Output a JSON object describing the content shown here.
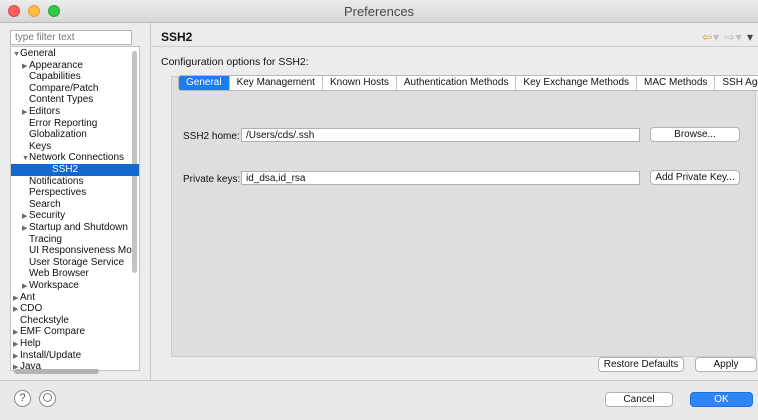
{
  "window": {
    "title": "Preferences"
  },
  "filter": {
    "placeholder": "type filter text"
  },
  "tree": [
    {
      "label": "General",
      "indent": 0,
      "twisty": "▼",
      "selected": false
    },
    {
      "label": "Appearance",
      "indent": 1,
      "twisty": "▶",
      "selected": false
    },
    {
      "label": "Capabilities",
      "indent": 1,
      "twisty": "",
      "selected": false
    },
    {
      "label": "Compare/Patch",
      "indent": 1,
      "twisty": "",
      "selected": false
    },
    {
      "label": "Content Types",
      "indent": 1,
      "twisty": "",
      "selected": false
    },
    {
      "label": "Editors",
      "indent": 1,
      "twisty": "▶",
      "selected": false
    },
    {
      "label": "Error Reporting",
      "indent": 1,
      "twisty": "",
      "selected": false
    },
    {
      "label": "Globalization",
      "indent": 1,
      "twisty": "",
      "selected": false
    },
    {
      "label": "Keys",
      "indent": 1,
      "twisty": "",
      "selected": false
    },
    {
      "label": "Network Connections",
      "indent": 1,
      "twisty": "▼",
      "selected": false
    },
    {
      "label": "SSH2",
      "indent": 2,
      "twisty": "",
      "selected": true
    },
    {
      "label": "Notifications",
      "indent": 1,
      "twisty": "",
      "selected": false
    },
    {
      "label": "Perspectives",
      "indent": 1,
      "twisty": "",
      "selected": false
    },
    {
      "label": "Search",
      "indent": 1,
      "twisty": "",
      "selected": false
    },
    {
      "label": "Security",
      "indent": 1,
      "twisty": "▶",
      "selected": false
    },
    {
      "label": "Startup and Shutdown",
      "indent": 1,
      "twisty": "▶",
      "selected": false
    },
    {
      "label": "Tracing",
      "indent": 1,
      "twisty": "",
      "selected": false
    },
    {
      "label": "UI Responsiveness Mo",
      "indent": 1,
      "twisty": "",
      "selected": false
    },
    {
      "label": "User Storage Service",
      "indent": 1,
      "twisty": "",
      "selected": false
    },
    {
      "label": "Web Browser",
      "indent": 1,
      "twisty": "",
      "selected": false
    },
    {
      "label": "Workspace",
      "indent": 1,
      "twisty": "▶",
      "selected": false
    },
    {
      "label": "Ant",
      "indent": 0,
      "twisty": "▶",
      "selected": false
    },
    {
      "label": "CDO",
      "indent": 0,
      "twisty": "▶",
      "selected": false
    },
    {
      "label": "Checkstyle",
      "indent": 0,
      "twisty": "",
      "selected": false
    },
    {
      "label": "EMF Compare",
      "indent": 0,
      "twisty": "▶",
      "selected": false
    },
    {
      "label": "Help",
      "indent": 0,
      "twisty": "▶",
      "selected": false
    },
    {
      "label": "Install/Update",
      "indent": 0,
      "twisty": "▶",
      "selected": false
    },
    {
      "label": "Java",
      "indent": 0,
      "twisty": "▶",
      "selected": false
    }
  ],
  "page": {
    "title": "SSH2",
    "description": "Configuration options for SSH2:",
    "nav": {
      "back": "⇦",
      "forward": "⇨",
      "menu": "▾"
    }
  },
  "tabs": [
    {
      "label": "General",
      "active": true
    },
    {
      "label": "Key Management",
      "active": false
    },
    {
      "label": "Known Hosts",
      "active": false
    },
    {
      "label": "Authentication Methods",
      "active": false
    },
    {
      "label": "Key Exchange Methods",
      "active": false
    },
    {
      "label": "MAC Methods",
      "active": false
    },
    {
      "label": "SSH Agent",
      "active": false
    }
  ],
  "general": {
    "ssh2_home_label": "SSH2 home:",
    "ssh2_home_value": "/Users/cds/.ssh",
    "browse_label": "Browse...",
    "private_keys_label": "Private keys:",
    "private_keys_value": "id_dsa,id_rsa",
    "add_key_label": "Add Private Key..."
  },
  "actions": {
    "restore": "Restore Defaults",
    "apply": "Apply",
    "cancel": "Cancel",
    "ok": "OK"
  },
  "help": {
    "help_glyph": "?"
  },
  "colors": {
    "accent": "#1d7cf0",
    "selection": "#1567d0"
  }
}
